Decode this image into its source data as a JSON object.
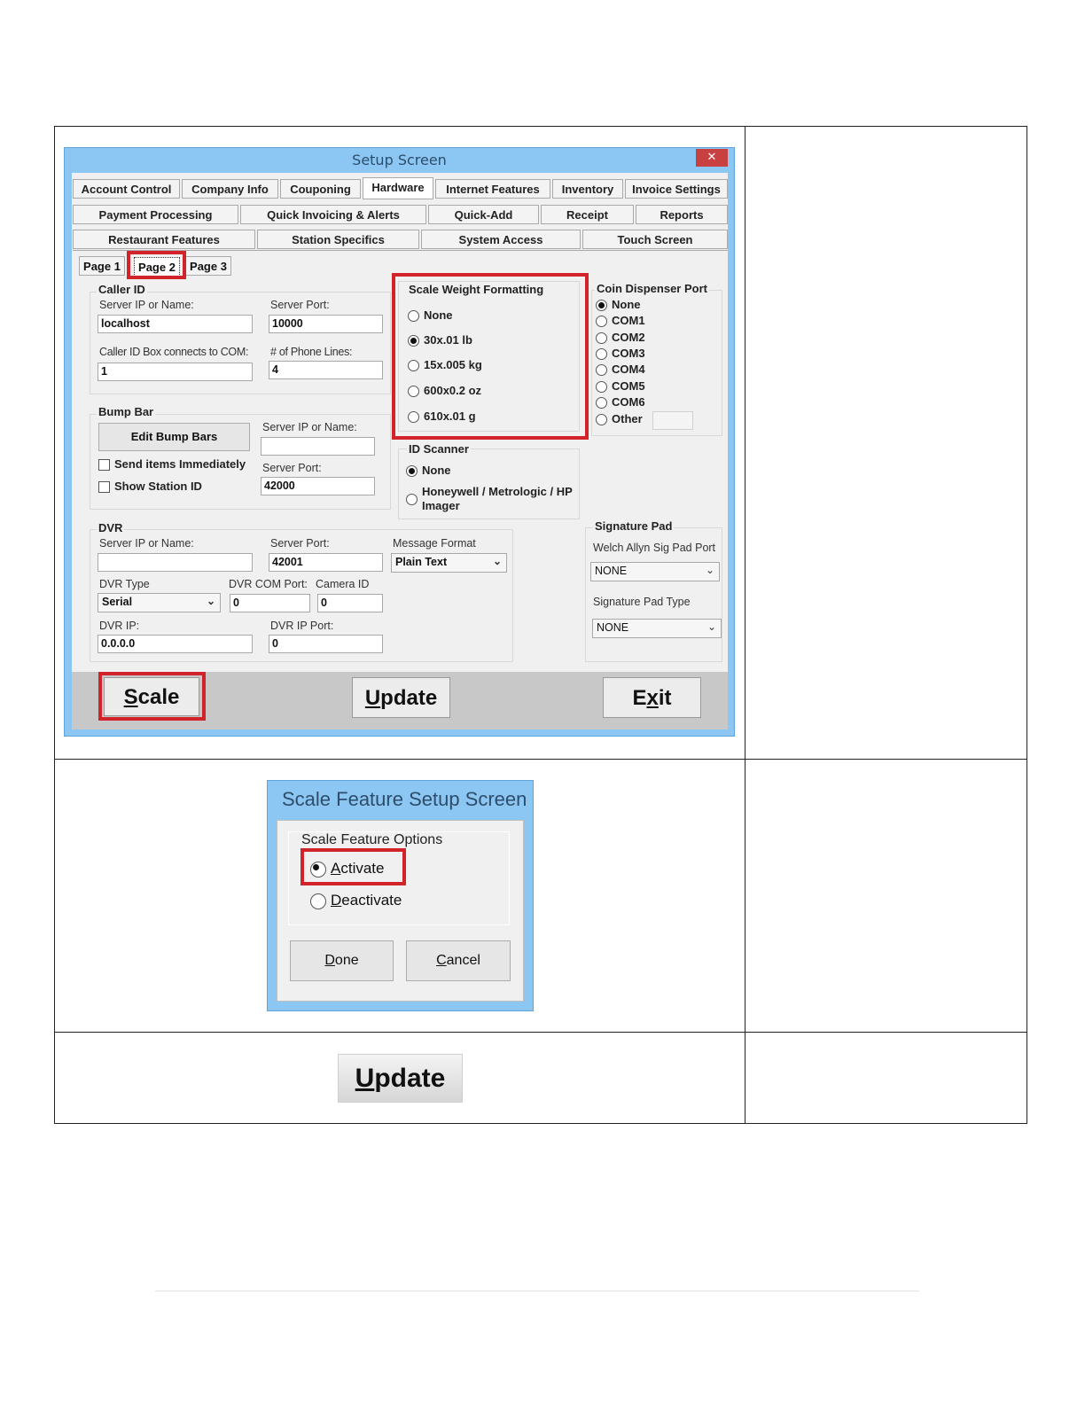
{
  "setup_window": {
    "title": "Setup Screen",
    "close_glyph": "✕",
    "tabs_row1": [
      "Account Control",
      "Company Info",
      "Couponing",
      "Hardware",
      "Internet Features",
      "Inventory",
      "Invoice Settings"
    ],
    "tabs_row2": [
      "Payment Processing",
      "Quick Invoicing & Alerts",
      "Quick-Add",
      "Receipt",
      "Reports"
    ],
    "tabs_row3": [
      "Restaurant Features",
      "Station Specifics",
      "System Access",
      "Touch Screen"
    ],
    "active_tab": "Hardware",
    "page_tabs": [
      "Page 1",
      "Page 2",
      "Page 3"
    ],
    "active_page": "Page 2",
    "caller_id": {
      "title": "Caller ID",
      "server_ip_label": "Server IP or Name:",
      "server_ip_value": "localhost",
      "server_port_label": "Server Port:",
      "server_port_value": "10000",
      "com_label": "Caller ID Box connects to COM:",
      "com_value": "1",
      "phone_lines_label": "# of Phone Lines:",
      "phone_lines_value": "4"
    },
    "bump_bar": {
      "title": "Bump Bar",
      "edit_button": "Edit Bump Bars",
      "send_items_label": "Send items Immediately",
      "send_items_checked": false,
      "show_station_label": "Show Station ID",
      "show_station_checked": false,
      "server_ip_label": "Server IP or Name:",
      "server_ip_value": "",
      "server_port_label": "Server Port:",
      "server_port_value": "42000"
    },
    "scale_weight": {
      "title": "Scale Weight Formatting",
      "options": [
        "None",
        "30x.01 lb",
        "15x.005 kg",
        "600x0.2 oz",
        "610x.01 g"
      ],
      "selected": "30x.01 lb"
    },
    "coin_dispenser": {
      "title": "Coin Dispenser Port",
      "options": [
        "None",
        "COM1",
        "COM2",
        "COM3",
        "COM4",
        "COM5",
        "COM6",
        "Other"
      ],
      "selected": "None",
      "other_value": ""
    },
    "id_scanner": {
      "title": "ID Scanner",
      "options": [
        "None",
        "Honeywell / Metrologic / HP Imager"
      ],
      "selected": "None"
    },
    "dvr": {
      "title": "DVR",
      "server_ip_label": "Server IP or Name:",
      "server_ip_value": "",
      "server_port_label": "Server Port:",
      "server_port_value": "42001",
      "message_format_label": "Message Format",
      "message_format_value": "Plain Text",
      "dvr_type_label": "DVR Type",
      "dvr_type_value": "Serial",
      "dvr_com_label": "DVR COM Port:",
      "dvr_com_value": "0",
      "camera_id_label": "Camera ID",
      "camera_id_value": "0",
      "dvr_ip_label": "DVR IP:",
      "dvr_ip_value": "0.0.0.0",
      "dvr_ip_port_label": "DVR IP Port:",
      "dvr_ip_port_value": "0"
    },
    "signature_pad": {
      "title": "Signature Pad",
      "welch_label": "Welch Allyn Sig Pad Port",
      "welch_value": "NONE",
      "type_label": "Signature Pad Type",
      "type_value": "NONE"
    },
    "buttons": {
      "scale_first": "S",
      "scale_rest": "cale",
      "update_first": "U",
      "update_rest": "pdate",
      "exit_first": "E",
      "exit_x": "x",
      "exit_rest": "it"
    },
    "chevron": "⌄"
  },
  "scale_window": {
    "title": "Scale Feature Setup Screen",
    "group_title": "Scale Feature Options",
    "activate_first": "A",
    "activate_rest": "ctivate",
    "deactivate_first": "D",
    "deactivate_rest": "eactivate",
    "selected": "Activate",
    "done_first": "D",
    "done_rest": "one",
    "cancel_first": "C",
    "cancel_rest": "ancel"
  },
  "update_snippet": {
    "first": "U",
    "rest": "pdate"
  },
  "colors": {
    "highlight_red": "#d2232a",
    "window_blue": "#8cc6f2"
  }
}
